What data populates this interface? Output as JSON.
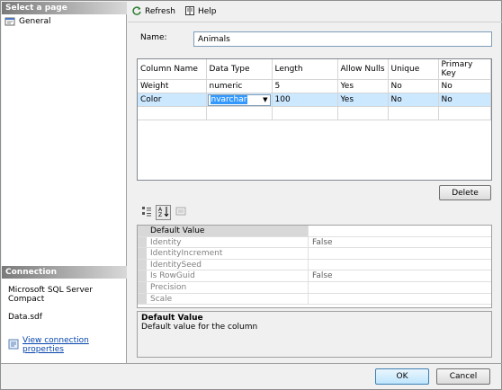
{
  "left_pane": {
    "pages_header": "Select a page",
    "pages": [
      {
        "label": "General"
      }
    ],
    "connection_header": "Connection",
    "server": "Microsoft SQL Server Compact",
    "database": "Data.sdf",
    "view_props_link": "View connection properties"
  },
  "toolbar": {
    "refresh_label": "Refresh",
    "help_label": "Help"
  },
  "form": {
    "name_label": "Name:",
    "name_value": "Animals"
  },
  "grid": {
    "columns": [
      "Column Name",
      "Data Type",
      "Length",
      "Allow Nulls",
      "Unique",
      "Primary Key"
    ],
    "rows": [
      [
        "Weight",
        "numeric",
        "5",
        "Yes",
        "No",
        "No"
      ],
      [
        "Color",
        "nvarchar",
        "100",
        "Yes",
        "No",
        "No"
      ]
    ],
    "selected_row": 1
  },
  "delete_label": "Delete",
  "properties": {
    "category": "Default Value",
    "items": [
      {
        "name": "Identity",
        "value": "False"
      },
      {
        "name": "IdentityIncrement",
        "value": ""
      },
      {
        "name": "IdentitySeed",
        "value": ""
      },
      {
        "name": "Is RowGuid",
        "value": "False"
      },
      {
        "name": "Precision",
        "value": ""
      },
      {
        "name": "Scale",
        "value": ""
      }
    ]
  },
  "description": {
    "title": "Default Value",
    "text": "Default value for the column"
  },
  "buttons": {
    "ok": "OK",
    "cancel": "Cancel"
  },
  "colors": {
    "selection": "#cce8ff",
    "link": "#0645ad",
    "header_gradient_start": "#7a7a7a"
  }
}
